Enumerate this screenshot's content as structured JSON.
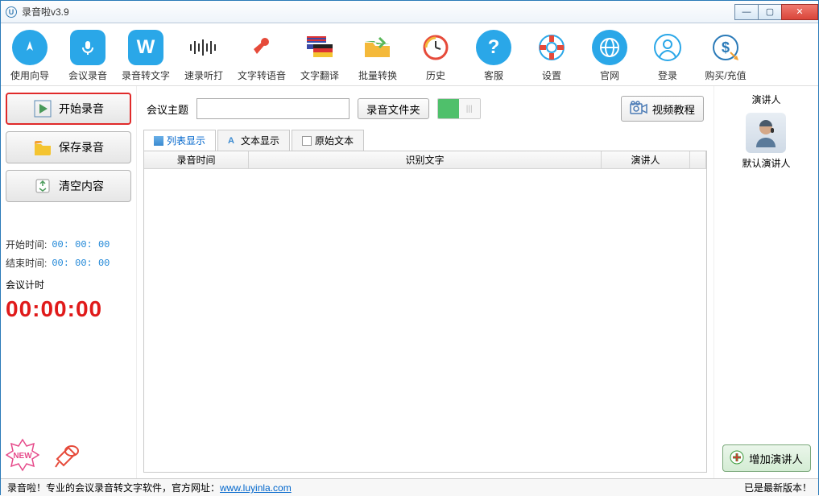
{
  "window": {
    "title": "录音啦v3.9"
  },
  "toolbar": [
    {
      "label": "使用向导",
      "icon": "compass",
      "bg": "#2aa7e8"
    },
    {
      "label": "会议录音",
      "icon": "mic",
      "bg": "#2aa7e8"
    },
    {
      "label": "录音转文字",
      "icon": "w",
      "bg": "#2aa7e8"
    },
    {
      "label": "速录听打",
      "icon": "wave",
      "bg": "#ffffff"
    },
    {
      "label": "文字转语音",
      "icon": "megaphone",
      "bg": "#ffffff"
    },
    {
      "label": "文字翻译",
      "icon": "flags",
      "bg": "#ffffff"
    },
    {
      "label": "批量转换",
      "icon": "folder",
      "bg": "#ffffff"
    },
    {
      "label": "历史",
      "icon": "clock",
      "bg": "#ffffff"
    },
    {
      "label": "客服",
      "icon": "help",
      "bg": "#2aa7e8"
    },
    {
      "label": "设置",
      "icon": "lifebuoy",
      "bg": "#ffffff"
    },
    {
      "label": "官网",
      "icon": "globe",
      "bg": "#2aa7e8"
    },
    {
      "label": "登录",
      "icon": "user",
      "bg": "#ffffff"
    },
    {
      "label": "购买/充值",
      "icon": "dollar",
      "bg": "#ffffff"
    }
  ],
  "left": {
    "start": "开始录音",
    "save": "保存录音",
    "clear": "清空内容",
    "start_time_label": "开始时间:",
    "start_time": "00: 00: 00",
    "end_time_label": "结束时间:",
    "end_time": "00: 00: 00",
    "timer_label": "会议计时",
    "timer": "00:00:00",
    "new_badge": "NEW"
  },
  "main": {
    "topic_label": "会议主题",
    "topic_value": "",
    "folder_btn": "录音文件夹",
    "video_btn": "视频教程",
    "tabs": {
      "list": "列表显示",
      "text": "文本显示",
      "raw": "原始文本"
    },
    "grid_headers": {
      "time": "录音时间",
      "text": "识别文字",
      "speaker": "演讲人"
    }
  },
  "right": {
    "title": "演讲人",
    "default_speaker": "默认演讲人",
    "add_btn": "增加演讲人"
  },
  "status": {
    "left_prefix": "录音啦！专业的会议录音转文字软件，官方网址：",
    "url": "www.luyinla.com",
    "right": "已是最新版本！"
  }
}
